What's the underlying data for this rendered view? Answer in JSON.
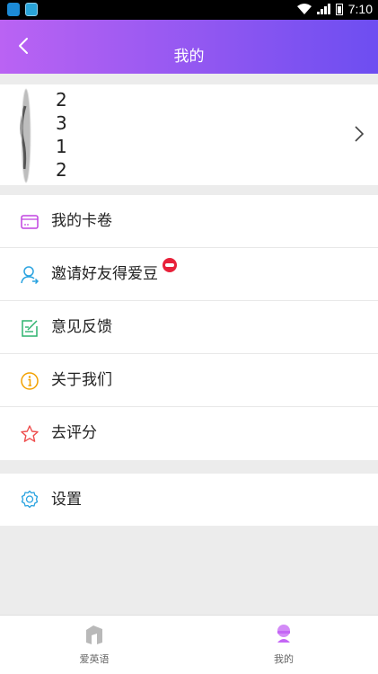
{
  "status_bar": {
    "time": "7:10"
  },
  "header": {
    "title": "我的"
  },
  "profile": {
    "digits": [
      "2",
      "3",
      "1",
      "2"
    ]
  },
  "menu": {
    "items": [
      {
        "label": "我的卡卷",
        "icon": "card-icon",
        "color": "#c142e0"
      },
      {
        "label": "邀请好友得爱豆",
        "icon": "invite-user-icon",
        "color": "#2aa3e0",
        "badge": "red-badge"
      },
      {
        "label": "意见反馈",
        "icon": "feedback-icon",
        "color": "#2db36e"
      },
      {
        "label": "关于我们",
        "icon": "info-icon",
        "color": "#f2a100"
      },
      {
        "label": "去评分",
        "icon": "star-icon",
        "color": "#ee4d4d"
      }
    ]
  },
  "settings": {
    "label": "设置",
    "icon": "settings-icon",
    "color": "#2aa3e0"
  },
  "tabbar": {
    "tabs": [
      {
        "label": "爱英语",
        "icon": "app-logo-icon",
        "active": false
      },
      {
        "label": "我的",
        "icon": "profile-icon",
        "active": true
      }
    ]
  },
  "colors": {
    "header_start": "#ba63f3",
    "header_end": "#6d4ef1",
    "accent": "#c142e0"
  }
}
